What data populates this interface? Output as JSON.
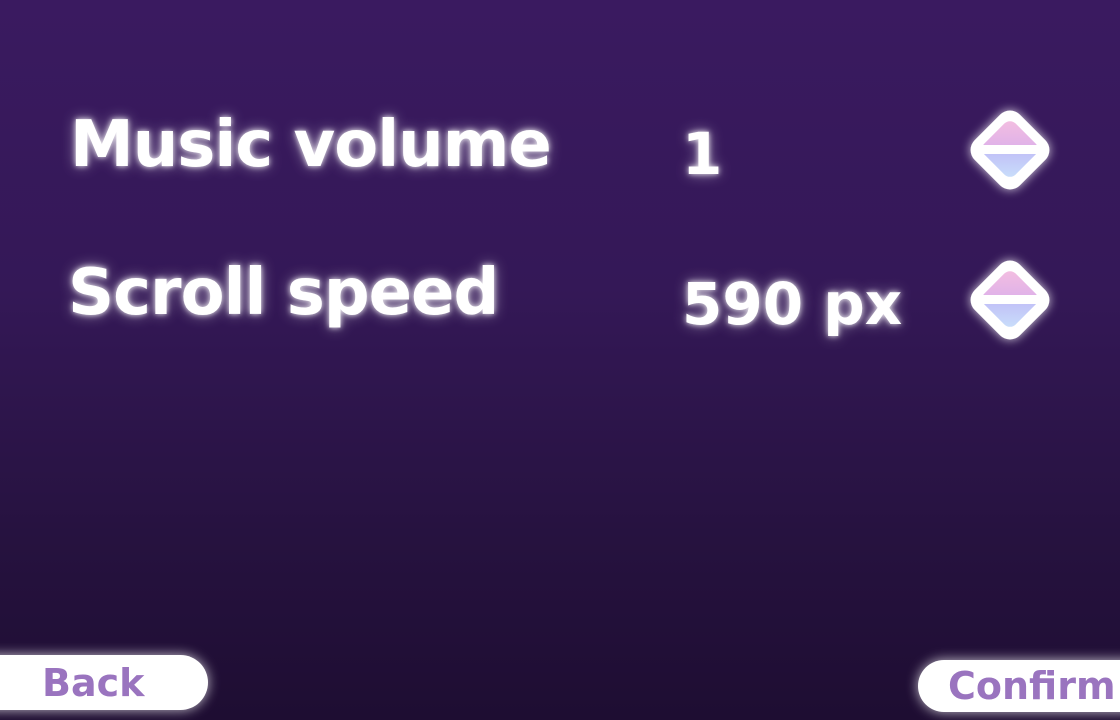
{
  "settings": [
    {
      "label": "Music volume",
      "value": "1"
    },
    {
      "label": "Scroll speed",
      "value": "590 px"
    }
  ],
  "buttons": {
    "back": "Back",
    "confirm": "Confirm"
  },
  "colors": {
    "button_text": "#9a74bf",
    "stepper_top": "#f5bfe0",
    "stepper_bottom": "#c9e0fb"
  }
}
